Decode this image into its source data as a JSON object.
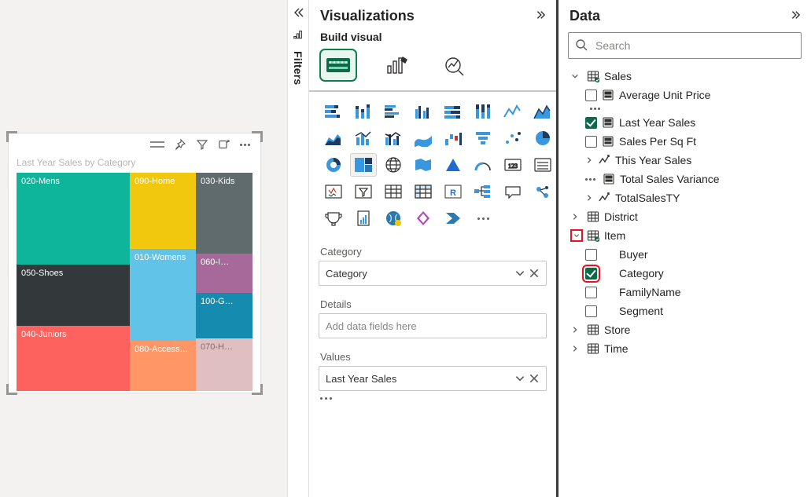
{
  "canvas": {
    "visual_title": "Last Year Sales by Category"
  },
  "chart_data": {
    "type": "treemap",
    "title": "Last Year Sales by Category",
    "value_meaning": "Area proportional to Last Year Sales (relative units, estimated)",
    "tiles": [
      {
        "label": "020-Mens",
        "value": 17.0,
        "color": "#0fb59b"
      },
      {
        "label": "090-Home",
        "value": 8.2,
        "color": "#f2c80f"
      },
      {
        "label": "030-Kids",
        "value": 7.5,
        "color": "#5f6b6d"
      },
      {
        "label": "050-Shoes",
        "value": 9.8,
        "color": "#33393b"
      },
      {
        "label": "010-Womens",
        "value": 9.8,
        "color": "#62c3e8"
      },
      {
        "label": "060-I…",
        "value": 3.3,
        "color": "#a66999"
      },
      {
        "label": "040-Juniors",
        "value": 8.2,
        "color": "#fd625e"
      },
      {
        "label": "100-G…",
        "value": 3.0,
        "color": "#158baf"
      },
      {
        "label": "080-Accesso…",
        "value": 4.8,
        "color": "#fe9666"
      },
      {
        "label": "070-H…",
        "value": 1.9,
        "color": "#dfbfbf"
      }
    ]
  },
  "filters": {
    "label": "Filters"
  },
  "viz": {
    "title": "Visualizations",
    "subtitle": "Build visual",
    "wells": {
      "category_label": "Category",
      "category_field": "Category",
      "details_label": "Details",
      "details_placeholder": "Add data fields here",
      "values_label": "Values",
      "values_field": "Last Year Sales"
    }
  },
  "data": {
    "title": "Data",
    "search_placeholder": "Search",
    "tree": {
      "sales": {
        "label": "Sales",
        "fields": {
          "avg_unit_price": "Average Unit Price",
          "last_year_sales": "Last Year Sales",
          "sales_per_sqft": "Sales Per Sq Ft",
          "this_year_sales": "This Year Sales",
          "total_sales_variance": "Total Sales Variance",
          "total_sales_ty": "TotalSalesTY"
        }
      },
      "district": "District",
      "item": {
        "label": "Item",
        "fields": {
          "buyer": "Buyer",
          "category": "Category",
          "family_name": "FamilyName",
          "segment": "Segment"
        }
      },
      "store": "Store",
      "time": "Time"
    }
  }
}
